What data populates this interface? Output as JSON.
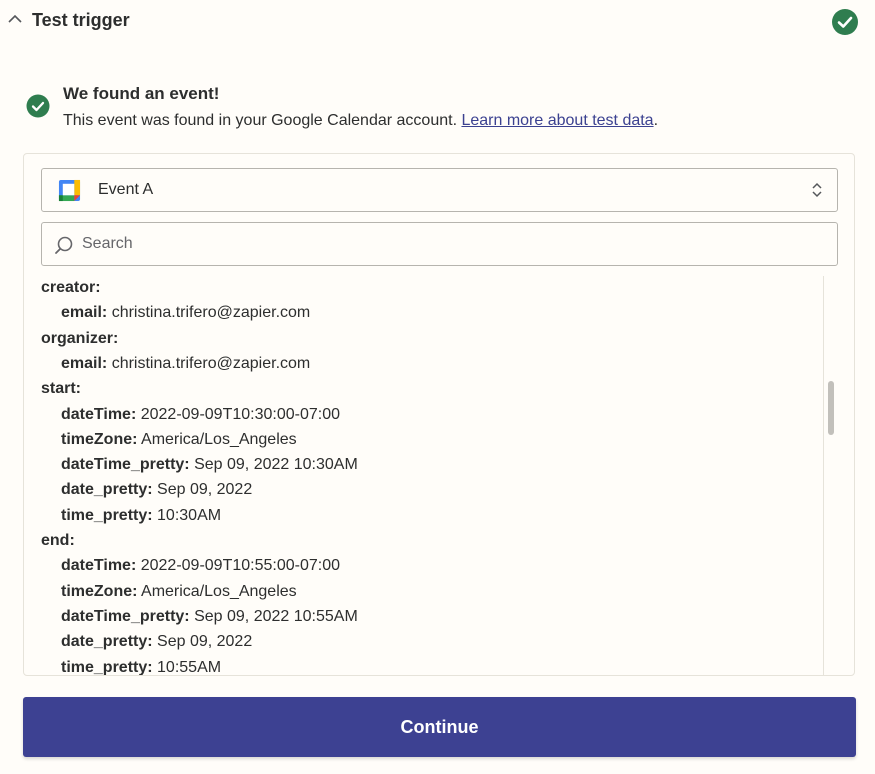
{
  "header": {
    "title": "Test trigger"
  },
  "found": {
    "title": "We found an event!",
    "desc_prefix": "This event was found in your Google Calendar account. ",
    "link": "Learn more about test data",
    "desc_suffix": "."
  },
  "select": {
    "value": "Event A"
  },
  "search": {
    "placeholder": "Search"
  },
  "fields": [
    {
      "key": "creator:",
      "value": "",
      "indent": 0
    },
    {
      "key": "email:",
      "value": "christina.trifero@zapier.com",
      "indent": 1
    },
    {
      "key": "organizer:",
      "value": "",
      "indent": 0
    },
    {
      "key": "email:",
      "value": "christina.trifero@zapier.com",
      "indent": 1
    },
    {
      "key": "start:",
      "value": "",
      "indent": 0
    },
    {
      "key": "dateTime:",
      "value": "2022-09-09T10:30:00-07:00",
      "indent": 1
    },
    {
      "key": "timeZone:",
      "value": "America/Los_Angeles",
      "indent": 1
    },
    {
      "key": "dateTime_pretty:",
      "value": "Sep 09, 2022 10:30AM",
      "indent": 1
    },
    {
      "key": "date_pretty:",
      "value": "Sep 09, 2022",
      "indent": 1
    },
    {
      "key": "time_pretty:",
      "value": "10:30AM",
      "indent": 1
    },
    {
      "key": "end:",
      "value": "",
      "indent": 0
    },
    {
      "key": "dateTime:",
      "value": "2022-09-09T10:55:00-07:00",
      "indent": 1
    },
    {
      "key": "timeZone:",
      "value": "America/Los_Angeles",
      "indent": 1
    },
    {
      "key": "dateTime_pretty:",
      "value": "Sep 09, 2022 10:55AM",
      "indent": 1
    },
    {
      "key": "date_pretty:",
      "value": "Sep 09, 2022",
      "indent": 1
    },
    {
      "key": "time_pretty:",
      "value": "10:55AM",
      "indent": 1
    }
  ],
  "actions": {
    "continue_label": "Continue"
  },
  "colors": {
    "accent": "#3d4192",
    "success": "#2f7d4f",
    "link": "#3b4190"
  },
  "icons": {
    "collapse": "chevron-up-icon",
    "done": "check-circle-icon",
    "app": "google-calendar-icon",
    "select": "chevron-up-down-icon",
    "search": "search-icon"
  }
}
